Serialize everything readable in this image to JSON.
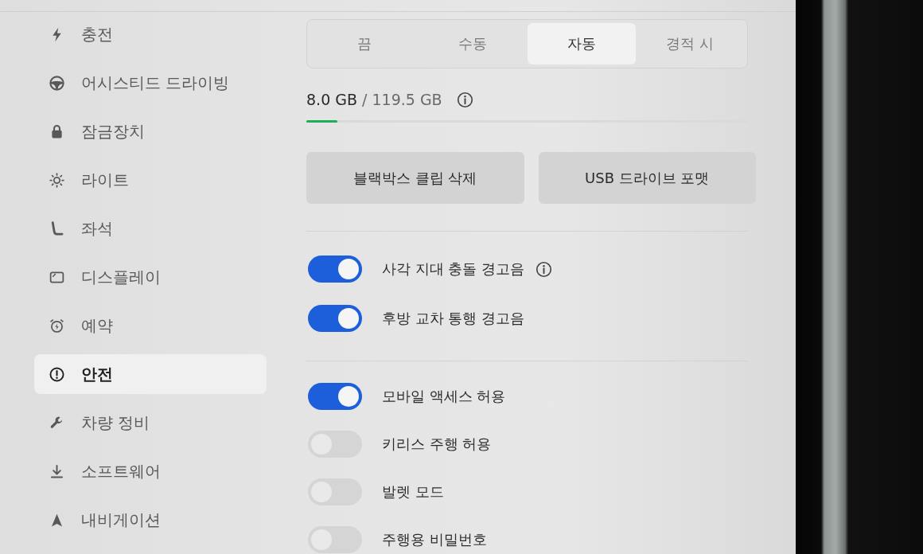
{
  "sidebar": {
    "items": [
      {
        "label": "충전",
        "selected": false
      },
      {
        "label": "어시스티드 드라이빙",
        "selected": false
      },
      {
        "label": "잠금장치",
        "selected": false
      },
      {
        "label": "라이트",
        "selected": false
      },
      {
        "label": "좌석",
        "selected": false
      },
      {
        "label": "디스플레이",
        "selected": false
      },
      {
        "label": "예약",
        "selected": false
      },
      {
        "label": "안전",
        "selected": true
      },
      {
        "label": "차량 정비",
        "selected": false
      },
      {
        "label": "소프트웨어",
        "selected": false
      },
      {
        "label": "내비게이션",
        "selected": false
      }
    ]
  },
  "mode_selector": {
    "options": [
      {
        "label": "끔",
        "selected": false
      },
      {
        "label": "수동",
        "selected": false
      },
      {
        "label": "자동",
        "selected": true
      },
      {
        "label": "경적 시",
        "selected": false
      }
    ]
  },
  "storage": {
    "used": "8.0 GB",
    "total": "/ 119.5 GB",
    "level": 0.07
  },
  "buttons": [
    "블랙박스 클립 삭제",
    "USB 드라이브 포맷"
  ],
  "toggle_groups": [
    {
      "toggles": [
        {
          "label": "사각 지대 충돌 경고음",
          "on": true,
          "info": true
        },
        {
          "label": "후방 교차 통행 경고음",
          "on": true,
          "info": false
        }
      ]
    },
    {
      "toggles": [
        {
          "label": "모바일 액세스 허용",
          "on": true,
          "info": false
        },
        {
          "label": "키리스 주행 허용",
          "on": false,
          "info": false
        },
        {
          "label": "발렛 모드",
          "on": false,
          "info": false
        },
        {
          "label": "주행용 비밀번호",
          "on": false,
          "info": false
        }
      ]
    }
  ]
}
